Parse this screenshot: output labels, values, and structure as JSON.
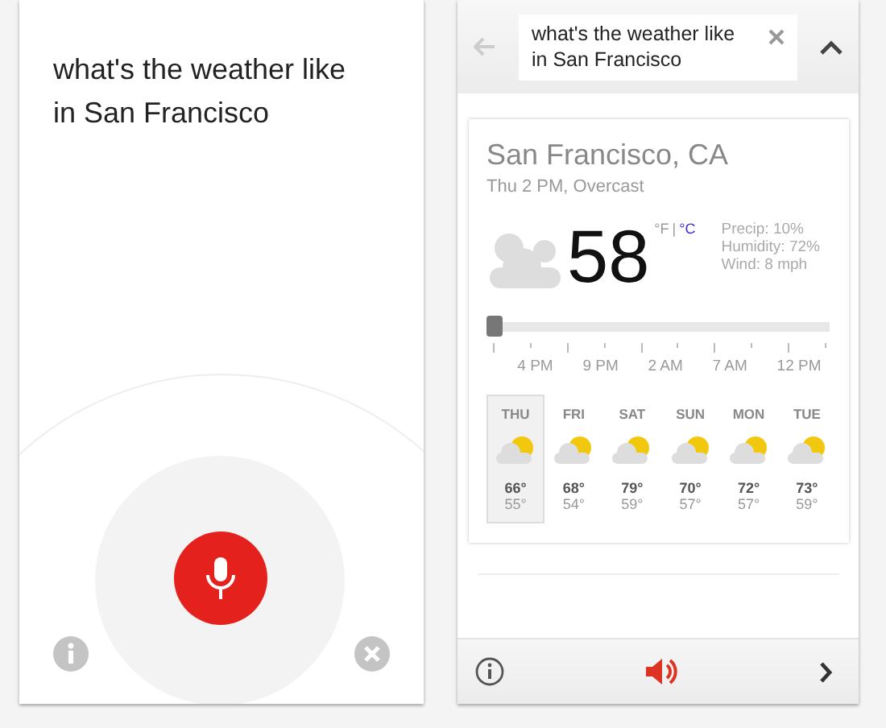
{
  "voice_screen": {
    "query": "what's the weather like in San Francisco"
  },
  "results_screen": {
    "search": {
      "value": "what's the weather like in San Francisco"
    },
    "weather": {
      "location": "San Francisco, CA",
      "condition": "Thu 2 PM, Overcast",
      "temperature": "58",
      "units": [
        {
          "label": "°F",
          "selected": true
        },
        {
          "label": "°C",
          "selected": false
        }
      ],
      "unit_separator": "|",
      "details": [
        "Precip: 10%",
        "Humidity: 72%",
        "Wind: 8 mph"
      ],
      "timeline": {
        "level": 0,
        "labels": [
          "4 PM",
          "9 PM",
          "2 AM",
          "7 AM",
          "12 PM"
        ]
      },
      "forecast": [
        {
          "day": "THU",
          "high": "66°",
          "low": "55°",
          "selected": true
        },
        {
          "day": "FRI",
          "high": "68°",
          "low": "54°",
          "selected": false
        },
        {
          "day": "SAT",
          "high": "79°",
          "low": "59°",
          "selected": false
        },
        {
          "day": "SUN",
          "high": "70°",
          "low": "57°",
          "selected": false
        },
        {
          "day": "MON",
          "high": "72°",
          "low": "57°",
          "selected": false
        },
        {
          "day": "TUE",
          "high": "73°",
          "low": "59°",
          "selected": false
        }
      ]
    }
  }
}
